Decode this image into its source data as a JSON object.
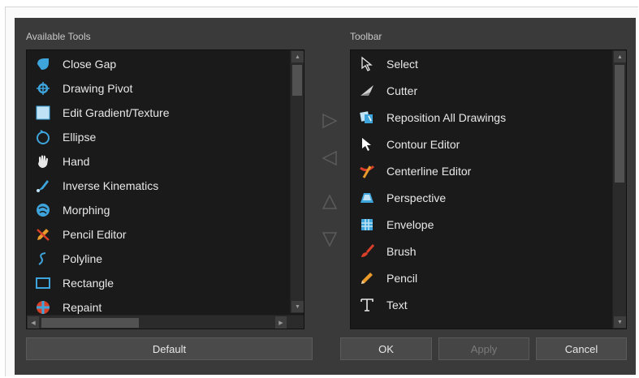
{
  "available_tools": {
    "label": "Available Tools",
    "items": [
      {
        "label": "Close Gap",
        "icon": "close-gap-icon"
      },
      {
        "label": "Drawing Pivot",
        "icon": "drawing-pivot-icon"
      },
      {
        "label": "Edit Gradient/Texture",
        "icon": "edit-gradient-texture-icon"
      },
      {
        "label": "Ellipse",
        "icon": "ellipse-icon"
      },
      {
        "label": "Hand",
        "icon": "hand-icon"
      },
      {
        "label": "Inverse Kinematics",
        "icon": "inverse-kinematics-icon"
      },
      {
        "label": "Morphing",
        "icon": "morphing-icon"
      },
      {
        "label": "Pencil Editor",
        "icon": "pencil-editor-icon"
      },
      {
        "label": "Polyline",
        "icon": "polyline-icon"
      },
      {
        "label": "Rectangle",
        "icon": "rectangle-icon"
      },
      {
        "label": "Repaint",
        "icon": "repaint-icon"
      }
    ]
  },
  "toolbar": {
    "label": "Toolbar",
    "items": [
      {
        "label": "Select",
        "icon": "select-arrow-icon"
      },
      {
        "label": "Cutter",
        "icon": "cutter-icon"
      },
      {
        "label": "Reposition All Drawings",
        "icon": "reposition-all-drawings-icon"
      },
      {
        "label": "Contour Editor",
        "icon": "contour-editor-icon"
      },
      {
        "label": "Centerline Editor",
        "icon": "centerline-editor-icon"
      },
      {
        "label": "Perspective",
        "icon": "perspective-icon"
      },
      {
        "label": "Envelope",
        "icon": "envelope-icon"
      },
      {
        "label": "Brush",
        "icon": "brush-icon"
      },
      {
        "label": "Pencil",
        "icon": "pencil-icon"
      },
      {
        "label": "Text",
        "icon": "text-icon"
      }
    ]
  },
  "move_controls": [
    {
      "name": "add-to-toolbar-button",
      "icon": "arrow-right-icon"
    },
    {
      "name": "remove-from-toolbar-button",
      "icon": "arrow-left-icon"
    },
    {
      "name": "move-up-button",
      "icon": "arrow-up-icon"
    },
    {
      "name": "move-down-button",
      "icon": "arrow-down-icon"
    }
  ],
  "buttons": {
    "default_label": "Default",
    "ok_label": "OK",
    "apply_label": "Apply",
    "cancel_label": "Cancel"
  },
  "colors": {
    "dialog_bg": "#3a3a3a",
    "list_bg": "#1a1a1a",
    "accent_blue": "#3ea4dc",
    "accent_red": "#d9402a",
    "accent_orange": "#e89a2b"
  }
}
